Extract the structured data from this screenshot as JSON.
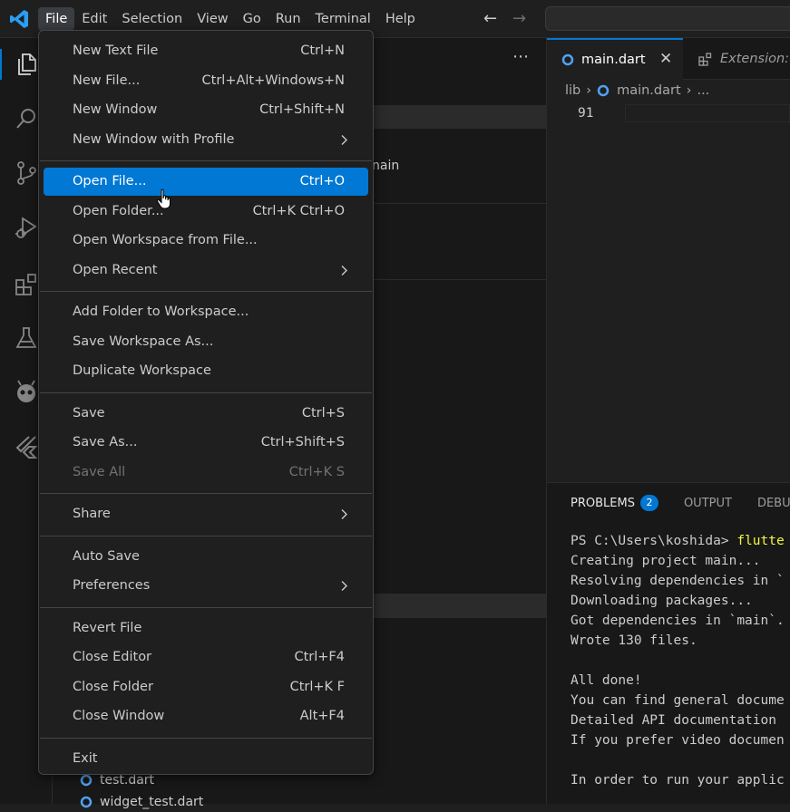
{
  "menubar": [
    "File",
    "Edit",
    "Selection",
    "View",
    "Go",
    "Run",
    "Terminal",
    "Help"
  ],
  "active_menu": "File",
  "editor": {
    "tabs": [
      {
        "label": "main.dart",
        "active": true
      },
      {
        "label": "Extension: F",
        "active": false
      }
    ],
    "breadcrumb": [
      "lib",
      "main.dart",
      "..."
    ],
    "line_number": "91"
  },
  "sidebar": {
    "partial_text": "nain",
    "files": [
      "test.dart",
      "widget_test.dart"
    ]
  },
  "panel": {
    "tabs": [
      {
        "label": "PROBLEMS",
        "badge": "2",
        "active": true
      },
      {
        "label": "OUTPUT",
        "active": false
      },
      {
        "label": "DEBUG",
        "active": false
      }
    ],
    "terminal": {
      "prompt": "PS C:\\Users\\koshida> ",
      "command": "flutte",
      "lines": [
        "Creating project main...",
        "Resolving dependencies in `",
        "Downloading packages...",
        "Got dependencies in `main`.",
        "Wrote 130 files.",
        "",
        "All done!",
        "You can find general docume",
        "Detailed API documentation",
        "If you prefer video documen",
        "",
        "In order to run your applic"
      ]
    }
  },
  "file_menu": {
    "items": [
      {
        "label": "New Text File",
        "shortcut": "Ctrl+N"
      },
      {
        "label": "New File...",
        "shortcut": "Ctrl+Alt+Windows+N"
      },
      {
        "label": "New Window",
        "shortcut": "Ctrl+Shift+N"
      },
      {
        "label": "New Window with Profile",
        "submenu": true
      },
      {
        "separator": true
      },
      {
        "label": "Open File...",
        "shortcut": "Ctrl+O",
        "highlighted": true
      },
      {
        "label": "Open Folder...",
        "shortcut": "Ctrl+K Ctrl+O"
      },
      {
        "label": "Open Workspace from File..."
      },
      {
        "label": "Open Recent",
        "submenu": true
      },
      {
        "separator": true
      },
      {
        "label": "Add Folder to Workspace..."
      },
      {
        "label": "Save Workspace As..."
      },
      {
        "label": "Duplicate Workspace"
      },
      {
        "separator": true
      },
      {
        "label": "Save",
        "shortcut": "Ctrl+S"
      },
      {
        "label": "Save As...",
        "shortcut": "Ctrl+Shift+S"
      },
      {
        "label": "Save All",
        "shortcut": "Ctrl+K S",
        "disabled": true
      },
      {
        "separator": true
      },
      {
        "label": "Share",
        "submenu": true
      },
      {
        "separator": true
      },
      {
        "label": "Auto Save"
      },
      {
        "label": "Preferences",
        "submenu": true
      },
      {
        "separator": true
      },
      {
        "label": "Revert File"
      },
      {
        "label": "Close Editor",
        "shortcut": "Ctrl+F4"
      },
      {
        "label": "Close Folder",
        "shortcut": "Ctrl+K F"
      },
      {
        "label": "Close Window",
        "shortcut": "Alt+F4"
      },
      {
        "separator": true
      },
      {
        "label": "Exit"
      }
    ]
  },
  "icons": {
    "activity": [
      "explorer-icon",
      "search-icon",
      "source-control-icon",
      "run-debug-icon",
      "extensions-icon",
      "testing-icon",
      "alien-extension-icon",
      "flutter-icon"
    ]
  },
  "colors": {
    "accent": "#0078d4",
    "background": "#1f1f1f",
    "sidebar": "#181818",
    "terminal_command": "#f5f543"
  }
}
